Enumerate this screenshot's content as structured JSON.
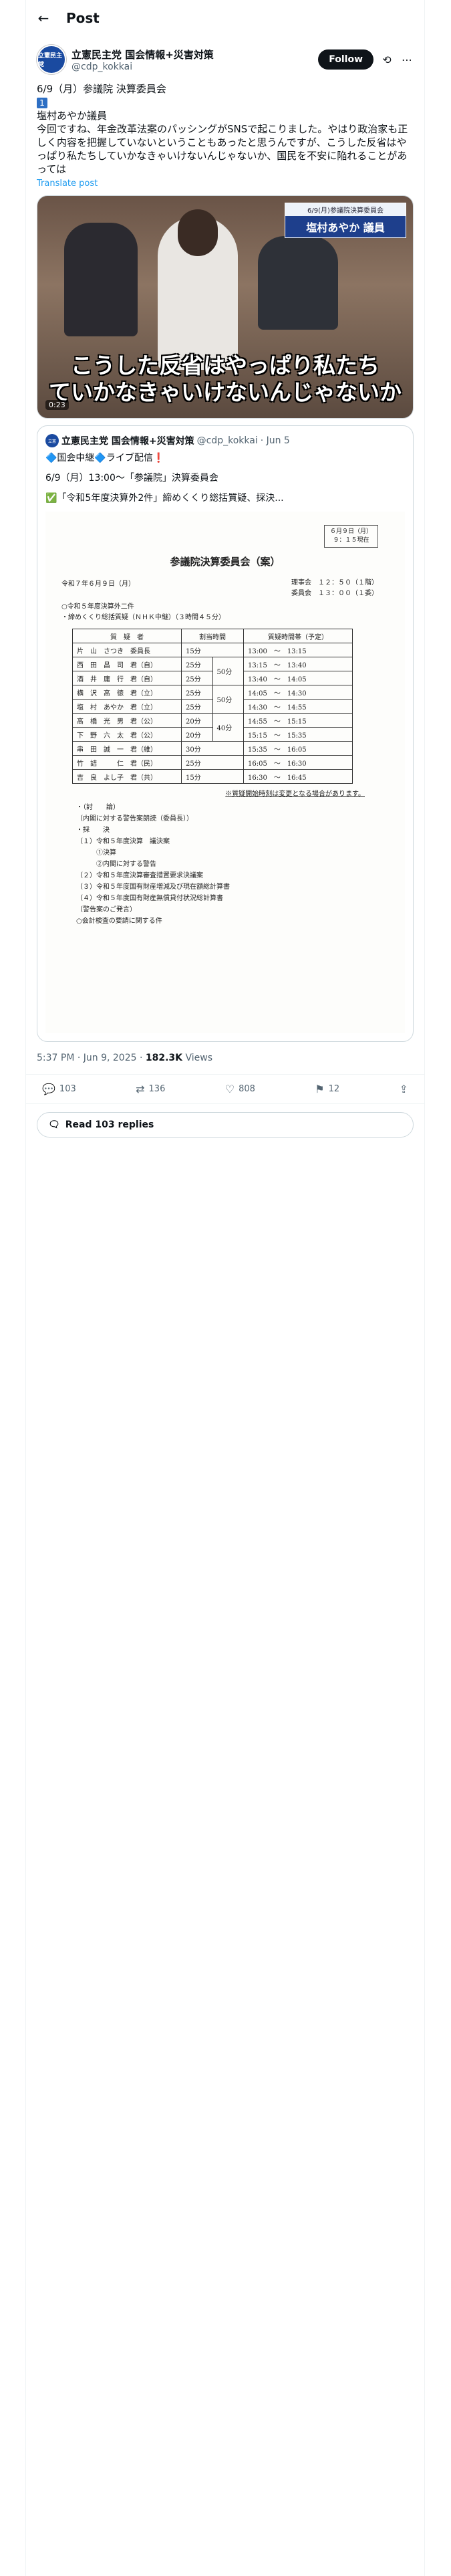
{
  "header": {
    "title": "Post",
    "back_icon": "←"
  },
  "author": {
    "display_name": "立憲民主党 国会情報+災害対策",
    "handle": "@cdp_kokkai",
    "avatar_text": "立憲民主党",
    "follow_label": "Follow",
    "icon_grok": "⟲",
    "icon_more": "⋯"
  },
  "post": {
    "line1": "6/9（月）参議院 決算委員会",
    "num_badge": "1",
    "line2": "塩村あやか議員",
    "line3": "今回ですね、年金改革法案のパッシングがSNSで起こりました。やはり政治家も正しく内容を把握していないということもあったと思うんですが、こうした反省はやっぱり私たちしていかなきゃいけないんじゃないか、国民を不安に陥れることがあっては",
    "translate": "Translate post"
  },
  "media": {
    "caption1": "こうした反省はやっぱり私たち",
    "caption2": "ていかなきゃいけないんじゃないか",
    "plate_top": "6/9(月)参議院決算委員会",
    "plate_name": "塩村あやか 議員",
    "time_badge": "0:23"
  },
  "quote": {
    "name": "立憲民主党 国会情報+災害対策",
    "handle": "@cdp_kokkai",
    "date": "· Jun 5",
    "line1": "🔷国会中継🔷ライブ配信❗",
    "line2": "6/9（月）13:00〜「参議院」決算委員会",
    "line3": "✅「令和5年度決算外2件」締めくくり総括質疑、採決..."
  },
  "doc": {
    "date_box1": "６月９日（月）",
    "date_box2": "９：１５現在",
    "title": "参議院決算委員会（案）",
    "date_line": "令和７年６月９日（月）",
    "time_line1": "理事会　１２：５０（１階）",
    "time_line2": "委員会　１３：００（１委）",
    "item1": "○令和５年度決算外二件",
    "item2": "・締めくくり総括質疑（ＮＨＫ中継）（３時間４５分）",
    "col_headers": [
      "質　疑　者",
      "割当時間",
      "",
      "質疑時間帯（予定）"
    ],
    "rows": [
      [
        "片　山　さつき　委員長",
        "15分",
        "",
        "13:00　〜　13:15"
      ],
      [
        "西　田　昌　司　君（自）",
        "25分",
        "50分",
        "13:15　〜　13:40"
      ],
      [
        "酒　井　庸　行　君（自）",
        "25分",
        "",
        "13:40　〜　14:05"
      ],
      [
        "横　沢　高　徳　君（立）",
        "25分",
        "50分",
        "14:05　〜　14:30"
      ],
      [
        "塩　村　あやか　君（立）",
        "25分",
        "",
        "14:30　〜　14:55"
      ],
      [
        "高　橋　光　男　君（公）",
        "20分",
        "40分",
        "14:55　〜　15:15"
      ],
      [
        "下　野　六　太　君（公）",
        "20分",
        "",
        "15:15　〜　15:35"
      ],
      [
        "串　田　誠　一　君（維）",
        "30分",
        "",
        "15:35　〜　16:05"
      ],
      [
        "竹　詰　　　仁　君（民）",
        "25分",
        "",
        "16:05　〜　16:30"
      ],
      [
        "吉　良　よし子　君（共）",
        "15分",
        "",
        "16:30　〜　16:45"
      ]
    ],
    "note_right": "※質疑開始時刻は変更となる場合があります。",
    "notes": [
      "・（討　　論）",
      "（内閣に対する警告案朗読（委員長））",
      "・採　　決",
      "（１）令和５年度決算　議決案",
      "　　　①決算",
      "　　　②内閣に対する警告",
      "（２）令和５年度決算審査措置要求決議案",
      "（３）令和５年度国有財産増減及び現在額総計算書",
      "（４）令和５年度国有財産無償貸付状況総計算書",
      "（警告案のご発言）",
      "○会計検査の要請に関する件"
    ]
  },
  "meta": {
    "time": "5:37 PM · Jun 9, 2025 · ",
    "views_num": "182.3K",
    "views_label": " Views"
  },
  "actions": {
    "replies": "103",
    "reposts": "136",
    "likes": "808",
    "bookmarks": "12"
  },
  "read_replies": "Read 103 replies"
}
